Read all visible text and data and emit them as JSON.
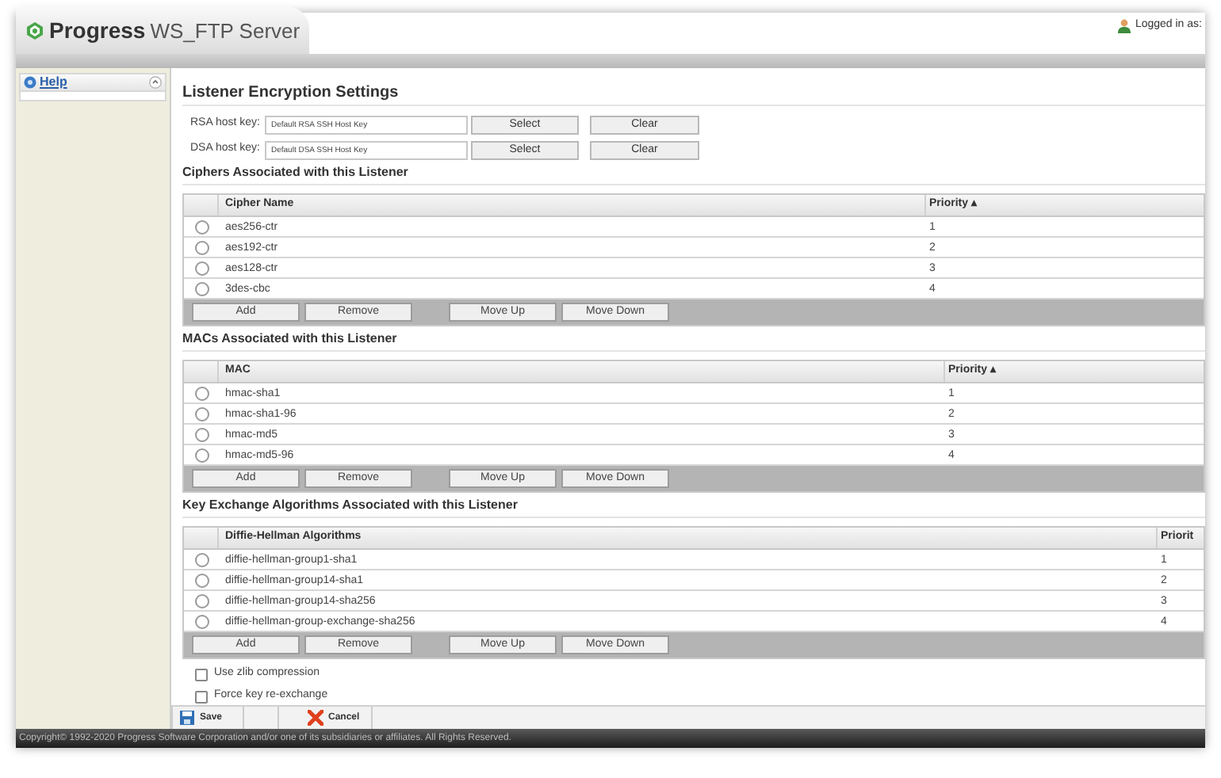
{
  "header": {
    "brand": "Progress",
    "product": "WS_FTP Server",
    "logged_in": "Logged in as:"
  },
  "sidebar": {
    "items": [
      {
        "label": "Help",
        "expanded": true
      }
    ]
  },
  "page": {
    "title": "Listener Encryption Settings",
    "host_keys": [
      {
        "label": "RSA host key:",
        "value": "Default RSA SSH Host Key",
        "buttons": [
          "Select",
          "Clear"
        ]
      },
      {
        "label": "DSA host key:",
        "value": "Default DSA SSH Host Key",
        "buttons": [
          "Select",
          "Clear"
        ]
      }
    ],
    "tables": [
      {
        "heading": "Ciphers Associated with this Listener",
        "columns": [
          "Cipher Name",
          "Priority ▴"
        ],
        "rows": [
          {
            "name": "aes256-ctr",
            "priority": "1",
            "selected": false
          },
          {
            "name": "aes192-ctr",
            "priority": "2",
            "selected": false
          },
          {
            "name": "aes128-ctr",
            "priority": "3",
            "selected": false
          },
          {
            "name": "3des-cbc",
            "priority": "4",
            "selected": false
          }
        ],
        "buttons": [
          "Add",
          "Remove",
          "Move Up",
          "Move Down"
        ]
      },
      {
        "heading": "MACs Associated with this Listener",
        "columns": [
          "MAC",
          "Priority ▴"
        ],
        "rows": [
          {
            "name": "hmac-sha1",
            "priority": "1",
            "selected": false
          },
          {
            "name": "hmac-sha1-96",
            "priority": "2",
            "selected": false
          },
          {
            "name": "hmac-md5",
            "priority": "3",
            "selected": false
          },
          {
            "name": "hmac-md5-96",
            "priority": "4",
            "selected": false
          }
        ],
        "buttons": [
          "Add",
          "Remove",
          "Move Up",
          "Move Down"
        ]
      },
      {
        "heading": "Key Exchange Algorithms Associated with this Listener",
        "columns": [
          "Diffie-Hellman Algorithms",
          "Priorit"
        ],
        "rows": [
          {
            "name": "diffie-hellman-group1-sha1",
            "priority": "1",
            "selected": false
          },
          {
            "name": "diffie-hellman-group14-sha1",
            "priority": "2",
            "selected": false
          },
          {
            "name": "diffie-hellman-group14-sha256",
            "priority": "3",
            "selected": false
          },
          {
            "name": "diffie-hellman-group-exchange-sha256",
            "priority": "4",
            "selected": false
          }
        ],
        "buttons": [
          "Add",
          "Remove",
          "Move Up",
          "Move Down"
        ]
      }
    ],
    "options": [
      {
        "label": "Use zlib compression",
        "checked": false
      },
      {
        "label": "Force key re-exchange",
        "checked": false
      }
    ]
  },
  "action_bar": [
    {
      "kind": "save",
      "label": "Save"
    },
    {
      "kind": "cancel",
      "label": "Cancel"
    }
  ],
  "footer": "Copyright© 1992-2020 Progress Software Corporation and/or one of its subsidiaries or affiliates. All Rights Reserved."
}
